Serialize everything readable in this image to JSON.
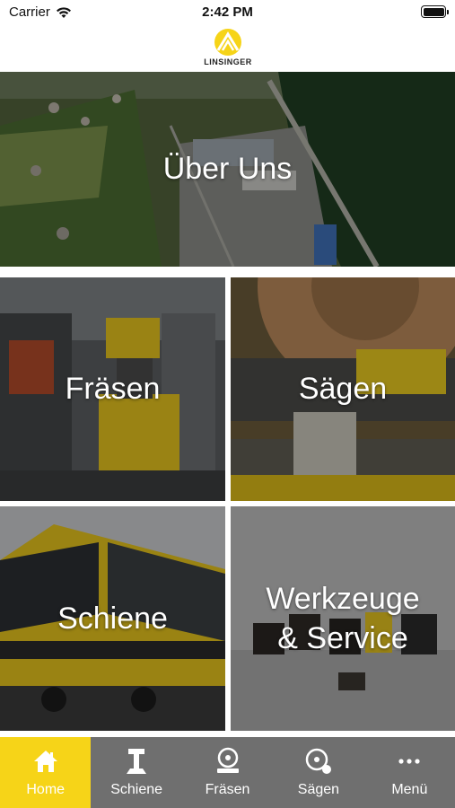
{
  "status_bar": {
    "carrier": "Carrier",
    "time": "2:42 PM",
    "battery_level": 1.0
  },
  "header": {
    "logo_text": "LINSINGER"
  },
  "tiles": [
    {
      "id": "uber",
      "label": "Über Uns",
      "scene": "aerial-factory-icon"
    },
    {
      "id": "fraesen",
      "label": "Fräsen",
      "scene": "milling-machine-icon"
    },
    {
      "id": "saegen",
      "label": "Sägen",
      "scene": "saw-blade-icon"
    },
    {
      "id": "schiene",
      "label": "Schiene",
      "scene": "rail-train-icon"
    },
    {
      "id": "werkzeuge",
      "label": "Werkzeuge\n& Service",
      "scene": "tool-inserts-icon"
    }
  ],
  "tab_bar": {
    "active_index": 0,
    "active_color": "#f6d418",
    "background_color": "#6f6f6f",
    "items": [
      {
        "label": "Home",
        "icon": "home-icon"
      },
      {
        "label": "Schiene",
        "icon": "rail-icon"
      },
      {
        "label": "Fräsen",
        "icon": "milling-icon"
      },
      {
        "label": "Sägen",
        "icon": "saw-icon"
      },
      {
        "label": "Menü",
        "icon": "more-dots-icon"
      }
    ]
  },
  "colors": {
    "brand_yellow": "#f6d418",
    "tab_gray": "#6f6f6f"
  }
}
